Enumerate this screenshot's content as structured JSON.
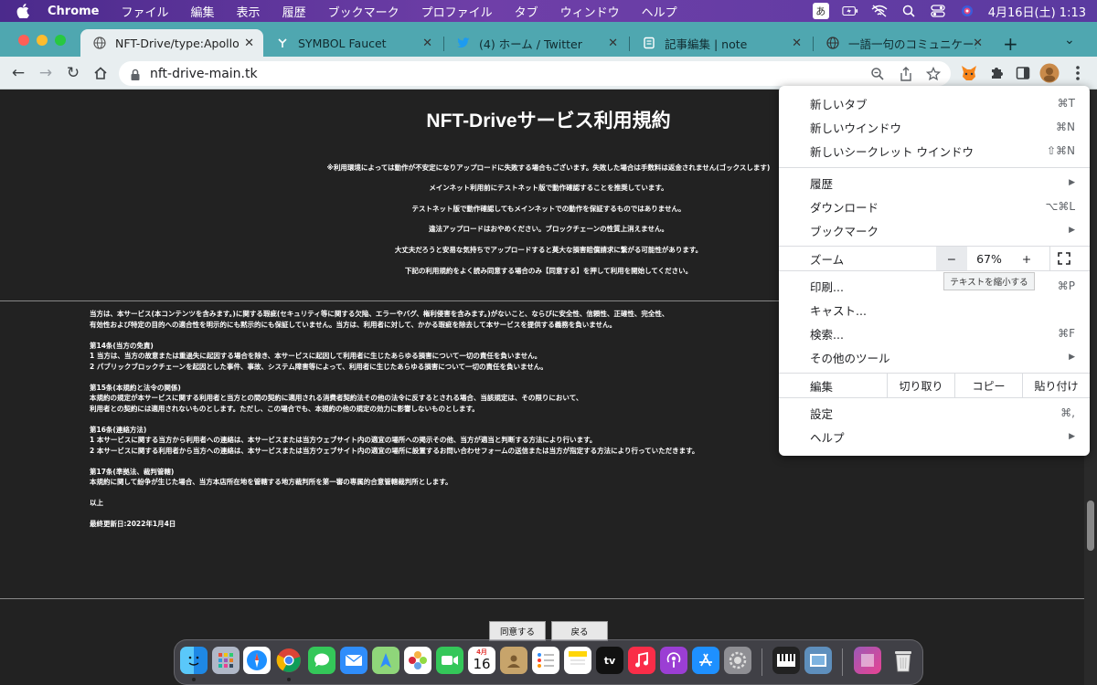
{
  "menubar": {
    "app": "Chrome",
    "items": [
      "ファイル",
      "編集",
      "表示",
      "履歴",
      "ブックマーク",
      "プロファイル",
      "タブ",
      "ウィンドウ",
      "ヘルプ"
    ],
    "ime": "あ",
    "datetime": "4月16日(土)  1:13"
  },
  "tabs": [
    {
      "label": "NFT-Drive/type:Apollo-MА",
      "favicon": "globe-icon",
      "active": true
    },
    {
      "label": "SYMBOL Faucet",
      "favicon": "symbol-icon",
      "active": false
    },
    {
      "label": "(4) ホーム / Twitter",
      "favicon": "twitter-icon",
      "active": false
    },
    {
      "label": "記事編集 | note",
      "favicon": "note-icon",
      "active": false
    },
    {
      "label": "一語一句のコミュニケーショ",
      "favicon": "globe-icon",
      "active": false
    }
  ],
  "toolbar": {
    "url": "nft-drive-main.tk"
  },
  "page": {
    "title": "NFT-Driveサービス利用規約",
    "notices": [
      "※利用環境によっては動作が不安定になりアップロードに失敗する場合もございます。失敗した場合は手数料は返金されません(ゴックスします)",
      "メインネット利用前にテストネット版で動作確認することを推奨しています。",
      "テストネット版で動作確認してもメインネットでの動作を保証するものではありません。",
      "違法アップロードはおやめください。ブロックチェーンの性質上消えません。",
      "大丈夫だろうと安易な気持ちでアップロードすると莫大な損害賠償請求に繋がる可能性があります。",
      "下記の利用規約をよく読み同意する場合のみ【同意する】を押して利用を開始してください。"
    ],
    "terms": [
      "当方は、本サービス(本コンテンツを含みます。)に関する瑕疵(セキュリティ等に関する欠陥、エラーやバグ、権利侵害を含みます。)がないこと、ならびに安全性、信頼性、正確性、完全性、",
      "有効性および特定の目的への適合性を明示的にも黙示的にも保証していません。当方は、利用者に対して、かかる瑕疵を除去して本サービスを提供する義務を負いません。",
      "",
      "第14条(当方の免責)",
      "1 当方は、当方の故意または重過失に起因する場合を除き、本サービスに起因して利用者に生じたあらゆる損害について一切の責任を負いません。",
      "2 パブリックブロックチェーンを起因とした事件、事故、システム障害等によって、利用者に生じたあらゆる損害について一切の責任を負いません。",
      "",
      "第15条(本規約と法令の関係)",
      "本規約の規定が本サービスに関する利用者と当方との間の契約に適用される消費者契約法その他の法令に反するとされる場合、当該規定は、その限りにおいて、",
      "利用者との契約には適用されないものとします。ただし、この場合でも、本規約の他の規定の効力に影響しないものとします。",
      "",
      "第16条(連絡方法)",
      "1 本サービスに関する当方から利用者への連絡は、本サービスまたは当方ウェブサイト内の適宜の場所への掲示その他、当方が適当と判断する方法により行います。",
      "2 本サービスに関する利用者から当方への連絡は、本サービスまたは当方ウェブサイト内の適宜の場所に設置するお問い合わせフォームの送信または当方が指定する方法により行っていただきます。",
      "",
      "第17条(準拠法、裁判管轄)",
      "本規約に関して紛争が生じた場合、当方本店所在地を管轄する地方裁判所を第一審の専属的合意管轄裁判所とします。",
      "",
      "以上",
      "",
      "最終更新日:2022年1月4日"
    ],
    "agree_button": "同意する",
    "back_button": "戻る"
  },
  "chrome_menu": {
    "new_tab": {
      "label": "新しいタブ",
      "shortcut": "⌘T"
    },
    "new_window": {
      "label": "新しいウインドウ",
      "shortcut": "⌘N"
    },
    "new_incognito": {
      "label": "新しいシークレット ウインドウ",
      "shortcut": "⇧⌘N"
    },
    "history": {
      "label": "履歴"
    },
    "downloads": {
      "label": "ダウンロード",
      "shortcut": "⌥⌘L"
    },
    "bookmarks": {
      "label": "ブックマーク"
    },
    "zoom": {
      "label": "ズーム",
      "minus": "−",
      "value": "67%",
      "plus": "+",
      "tooltip": "テキストを縮小する"
    },
    "print": {
      "label": "印刷...",
      "shortcut": "⌘P"
    },
    "cast": {
      "label": "キャスト..."
    },
    "find": {
      "label": "検索...",
      "shortcut": "⌘F"
    },
    "more_tools": {
      "label": "その他のツール"
    },
    "edit": {
      "label": "編集",
      "cut": "切り取り",
      "copy": "コピー",
      "paste": "貼り付け"
    },
    "settings": {
      "label": "設定",
      "shortcut": "⌘,"
    },
    "help": {
      "label": "ヘルプ"
    }
  },
  "dock": {
    "calendar_month": "4月",
    "calendar_day": "16",
    "tv_label": "tv"
  },
  "colors": {
    "tabstrip": "#4fa7b0",
    "page_bg": "#222222",
    "menubar": "#5a3aa0"
  }
}
